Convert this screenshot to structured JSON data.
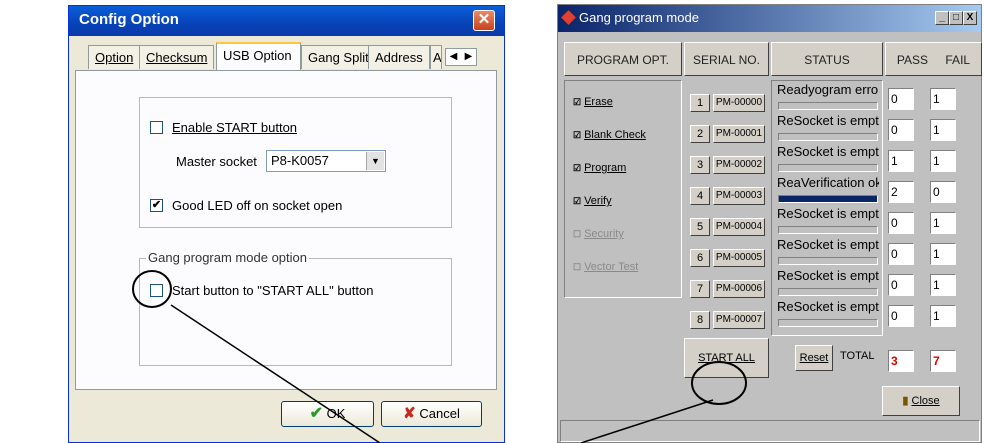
{
  "config_dialog": {
    "title": "Config Option",
    "close_glyph": "✕",
    "tabs": [
      "Option",
      "Checksum",
      "USB Option",
      "Gang Split",
      "Address",
      "A"
    ],
    "selected_tab": "USB Option",
    "enable_start": {
      "label": "Enable START button",
      "checked": false
    },
    "master_socket": {
      "label": "Master socket",
      "value": "P8-K0057"
    },
    "good_led": {
      "label": "Good LED off on socket open",
      "checked": true
    },
    "gang_group": {
      "legend": "Gang program mode option"
    },
    "start_all": {
      "label": "Start button to \"START ALL\" button",
      "checked": false
    },
    "ok_label": "OK",
    "cancel_label": "Cancel"
  },
  "gang_dialog": {
    "title": "Gang program mode",
    "headers": {
      "program_opt": "PROGRAM OPT.",
      "serial": "SERIAL NO.",
      "status": "STATUS",
      "pass": "PASS",
      "fail": "FAIL"
    },
    "options": [
      {
        "label": "Erase",
        "checked": true,
        "enabled": true
      },
      {
        "label": "Blank Check",
        "checked": true,
        "enabled": true
      },
      {
        "label": "Program",
        "checked": true,
        "enabled": true
      },
      {
        "label": "Verify",
        "checked": true,
        "enabled": true
      },
      {
        "label": "Security",
        "checked": false,
        "enabled": false
      },
      {
        "label": "Vector Test",
        "checked": false,
        "enabled": false
      }
    ],
    "sockets": [
      {
        "num": "1",
        "serial": "PM-00000",
        "status": "Readyogram error!",
        "pass": "0",
        "fail": "1",
        "progress": 0
      },
      {
        "num": "2",
        "serial": "PM-00001",
        "status": "ReSocket is empty!",
        "pass": "0",
        "fail": "1",
        "progress": 0
      },
      {
        "num": "3",
        "serial": "PM-00002",
        "status": "ReSocket is empty!",
        "pass": "1",
        "fail": "1",
        "progress": 0
      },
      {
        "num": "4",
        "serial": "PM-00003",
        "status": "ReaVerification ok!",
        "pass": "2",
        "fail": "0",
        "progress": 1
      },
      {
        "num": "5",
        "serial": "PM-00004",
        "status": "ReSocket is empty!",
        "pass": "0",
        "fail": "1",
        "progress": 0
      },
      {
        "num": "6",
        "serial": "PM-00005",
        "status": "ReSocket is empty!",
        "pass": "0",
        "fail": "1",
        "progress": 0
      },
      {
        "num": "7",
        "serial": "PM-00006",
        "status": "ReSocket is empty!",
        "pass": "0",
        "fail": "1",
        "progress": 0
      },
      {
        "num": "8",
        "serial": "PM-00007",
        "status": "ReSocket is empty!",
        "pass": "0",
        "fail": "1",
        "progress": 0
      }
    ],
    "start_all_label": "START ALL",
    "reset_label": "Reset",
    "total_label": "TOTAL",
    "total_pass": "3",
    "total_fail": "7",
    "close_label": "Close",
    "window_buttons": [
      "_",
      "□",
      "X"
    ]
  },
  "colors": {
    "xp_title": "#0a4ecb",
    "progress_fill": "#0a246a",
    "total_red": "#e00000"
  }
}
